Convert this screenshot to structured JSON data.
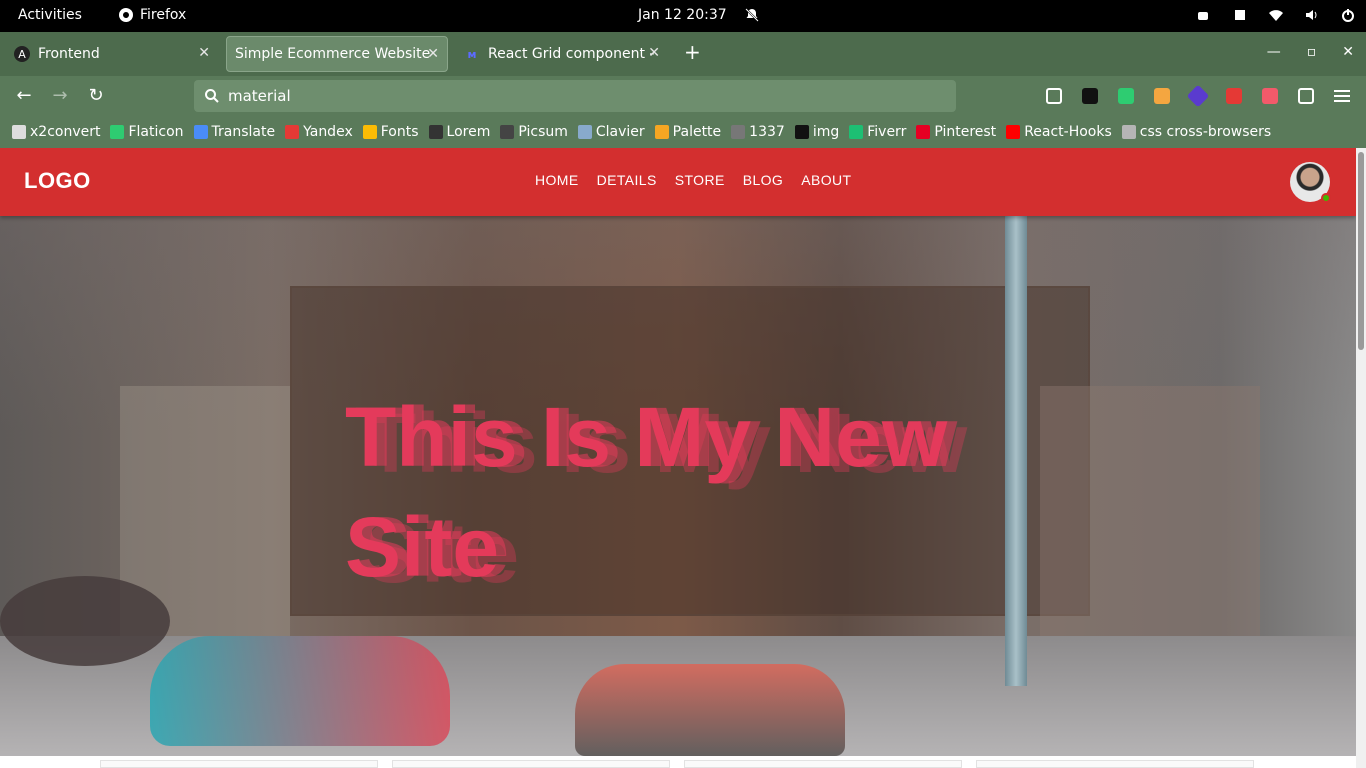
{
  "system_bar": {
    "activities": "Activities",
    "app_name": "Firefox",
    "clock": "Jan 12  20:37"
  },
  "browser": {
    "tabs": [
      {
        "label": "Frontend",
        "icon": "angular-icon"
      },
      {
        "label": "Simple Ecommerce Website",
        "icon": "none"
      },
      {
        "label": "React Grid component - M",
        "icon": "mui-icon"
      }
    ],
    "url": "material",
    "bookmarks": [
      {
        "label": "x2convert",
        "color": "#dddddd"
      },
      {
        "label": "Flaticon",
        "color": "#2ecc71"
      },
      {
        "label": "Translate",
        "color": "#4a8cf7"
      },
      {
        "label": "Yandex",
        "color": "#e53935"
      },
      {
        "label": "Fonts",
        "color": "#fbbc04"
      },
      {
        "label": "Lorem",
        "color": "#333333"
      },
      {
        "label": "Picsum",
        "color": "#444444"
      },
      {
        "label": "Clavier",
        "color": "#88aacc"
      },
      {
        "label": "Palette",
        "color": "#f5a623"
      },
      {
        "label": "1337",
        "color": "#777777"
      },
      {
        "label": "img",
        "color": "#111111"
      },
      {
        "label": "Fiverr",
        "color": "#1dbf73"
      },
      {
        "label": "Pinterest",
        "color": "#e60023"
      },
      {
        "label": "React-Hooks",
        "color": "#ff0000"
      },
      {
        "label": "css cross-browsers",
        "color": "#b5b5b5"
      }
    ]
  },
  "site": {
    "logo": "LOGO",
    "nav": [
      "HOME",
      "DETAILS",
      "STORE",
      "BLOG",
      "ABOUT"
    ],
    "hero_title": "This Is My New Site",
    "accent_color": "#d32f2f",
    "status_color": "#44b700"
  }
}
